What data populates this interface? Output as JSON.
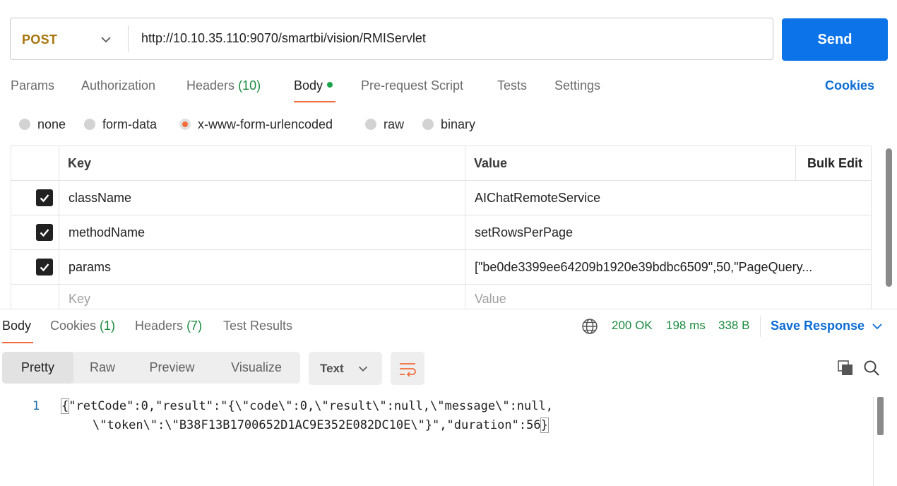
{
  "request": {
    "method": "POST",
    "url": "http://10.10.35.110:9070/smartbi/vision/RMIServlet",
    "send_label": "Send"
  },
  "tabs": {
    "params": "Params",
    "authorization": "Authorization",
    "headers": "Headers",
    "headers_count": "(10)",
    "body": "Body",
    "prerequest": "Pre-request Script",
    "tests": "Tests",
    "settings": "Settings",
    "cookies": "Cookies"
  },
  "body_types": {
    "none": "none",
    "form_data": "form-data",
    "urlencoded": "x-www-form-urlencoded",
    "raw": "raw",
    "binary": "binary",
    "selected": "x-www-form-urlencoded"
  },
  "params_table": {
    "col_key": "Key",
    "col_value": "Value",
    "bulk_edit": "Bulk Edit",
    "rows": [
      {
        "key": "className",
        "value": "AIChatRemoteService",
        "checked": true
      },
      {
        "key": "methodName",
        "value": "setRowsPerPage",
        "checked": true
      },
      {
        "key": "params",
        "value": "[\"be0de3399ee64209b1920e39bdbc6509\",50,\"PageQuery...",
        "checked": true
      }
    ],
    "placeholder_key": "Key",
    "placeholder_value": "Value"
  },
  "response": {
    "tabs": {
      "body": "Body",
      "cookies": "Cookies",
      "cookies_count": "(1)",
      "headers": "Headers",
      "headers_count": "(7)",
      "test_results": "Test Results"
    },
    "status": "200 OK",
    "time": "198 ms",
    "size": "338 B",
    "save_label": "Save Response",
    "views": {
      "pretty": "Pretty",
      "raw": "Raw",
      "preview": "Preview",
      "visualize": "Visualize"
    },
    "format": "Text",
    "line_number": "1",
    "line1_start": "{",
    "line1_rest": "\"retCode\":0,\"result\":\"{\\\"code\\\":0,\\\"result\\\":null,\\\"message\\\":null,",
    "line2_main": "\\\"token\\\":\\\"B38F13B1700652D1AC9E352E082DC10E\\\"}\",\"duration\":56",
    "line2_end": "}"
  },
  "colors": {
    "accent_orange": "#f26b3a",
    "send_blue": "#0c73e8",
    "link_blue": "#0c6cd4",
    "method_gold": "#a8740b",
    "status_green": "#1a8a3f"
  }
}
